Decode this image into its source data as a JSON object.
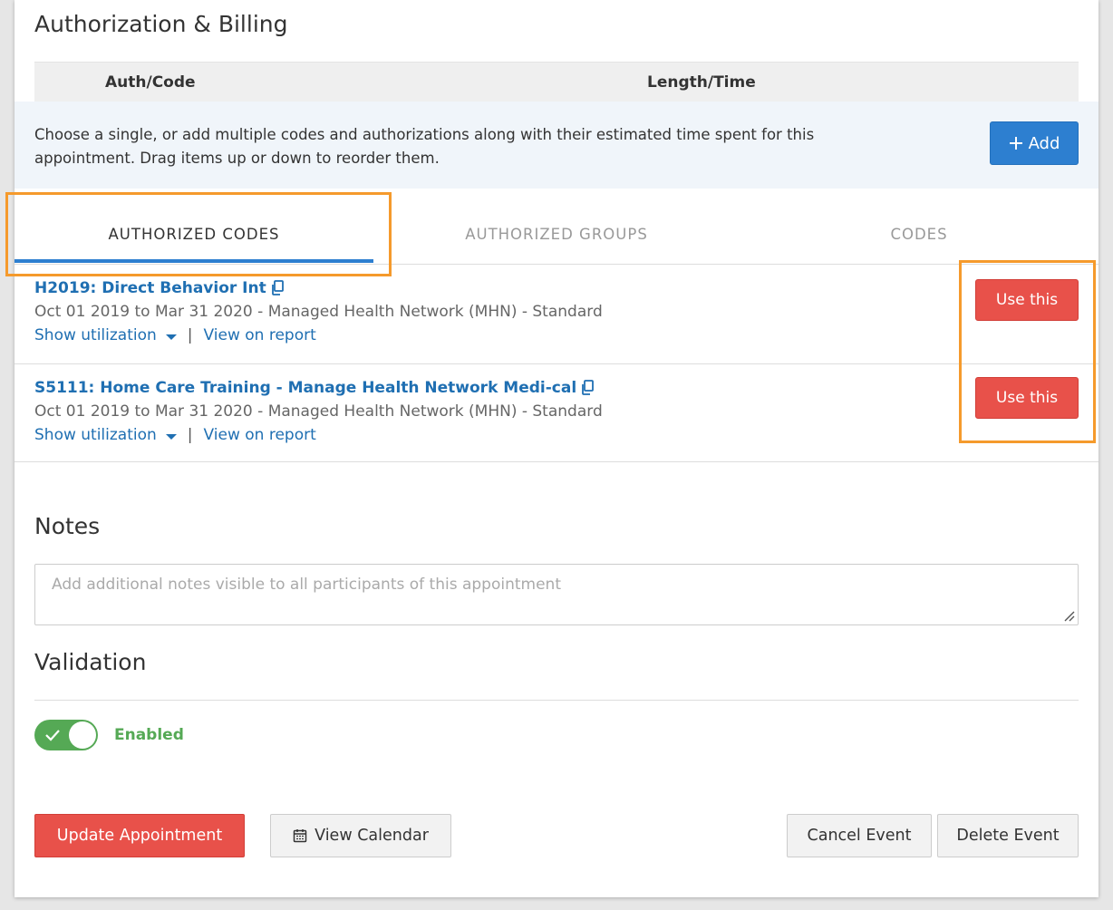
{
  "billing": {
    "title": "Authorization & Billing",
    "col_auth": "Auth/Code",
    "col_length": "Length/Time",
    "info": "Choose a single, or add multiple codes and authorizations along with their estimated time spent for this appointment. Drag items up or down to reorder them.",
    "add_label": "Add"
  },
  "tabs": [
    {
      "label": "AUTHORIZED CODES",
      "active": true
    },
    {
      "label": "AUTHORIZED GROUPS",
      "active": false
    },
    {
      "label": "CODES",
      "active": false
    }
  ],
  "items": [
    {
      "title": "H2019: Direct Behavior Int",
      "subtitle": "Oct 01 2019 to Mar 31 2020 - Managed Health Network (MHN) - Standard",
      "show_utilization": "Show utilization",
      "sep": "|",
      "view_report": "View on report",
      "use_label": "Use this"
    },
    {
      "title": "S5111: Home Care Training - Manage Health Network Medi-cal",
      "subtitle": "Oct 01 2019 to Mar 31 2020 - Managed Health Network (MHN) - Standard",
      "show_utilization": "Show utilization",
      "sep": "|",
      "view_report": "View on report",
      "use_label": "Use this"
    }
  ],
  "notes": {
    "title": "Notes",
    "placeholder": "Add additional notes visible to all participants of this appointment"
  },
  "validation": {
    "title": "Validation",
    "toggle_label": "Enabled"
  },
  "actions": {
    "update": "Update Appointment",
    "calendar": "View Calendar",
    "cancel": "Cancel Event",
    "delete": "Delete Event"
  },
  "colors": {
    "primary_blue": "#2d7fd0",
    "danger_red": "#e8514a",
    "success_green": "#55a955",
    "highlight_orange": "#f59a2c"
  },
  "icons": {
    "add": "plus-icon",
    "copy": "copy-icon",
    "caret": "caret-down-icon",
    "calendar": "calendar-icon",
    "check": "check-icon"
  }
}
